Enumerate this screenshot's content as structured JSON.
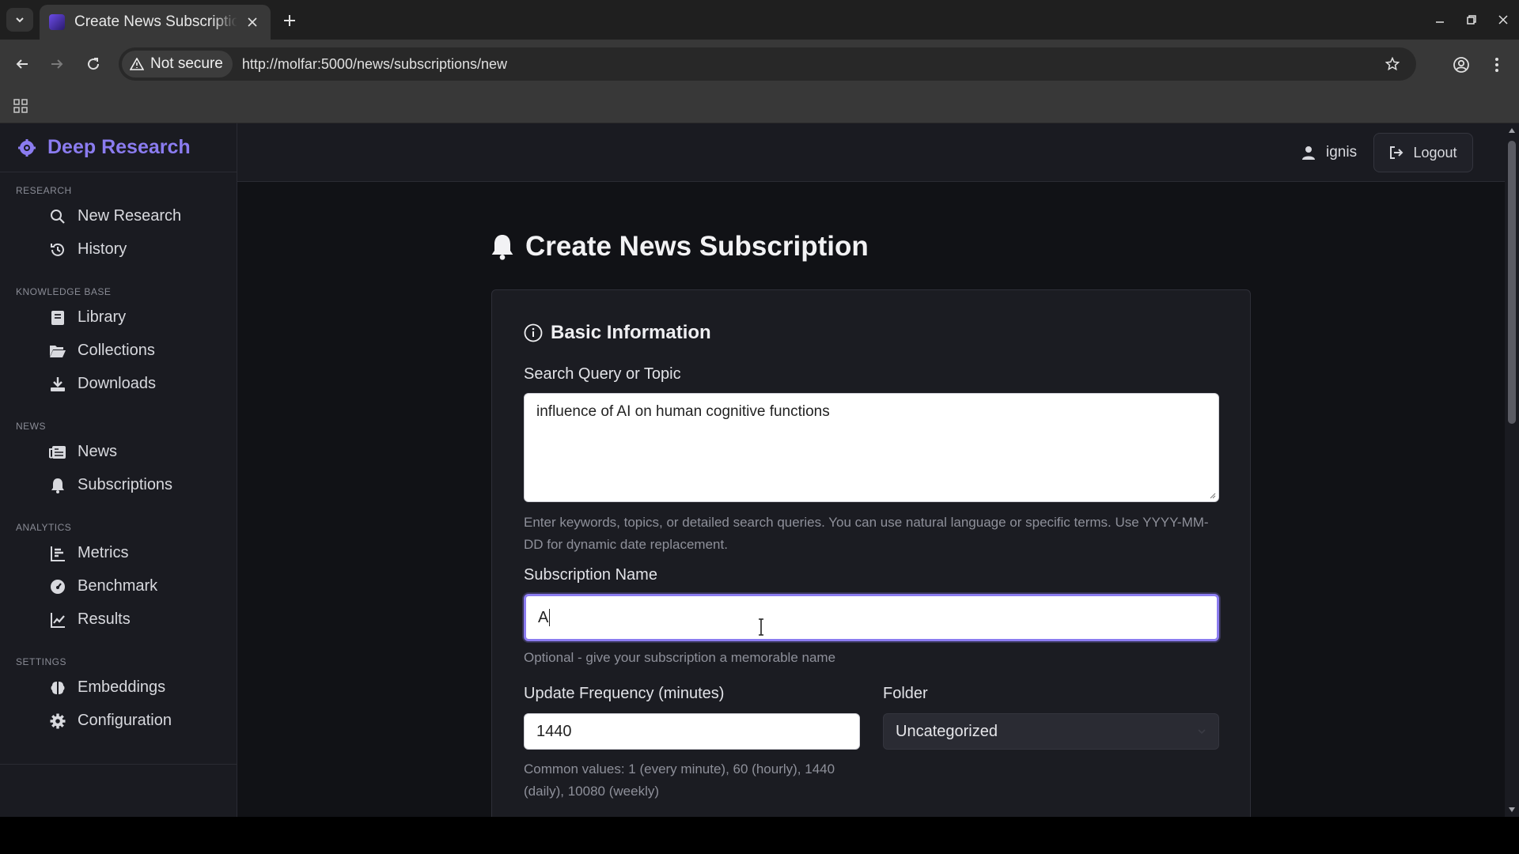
{
  "browser": {
    "tab_title": "Create News Subscription",
    "security_label": "Not secure",
    "url": "http://molfar:5000/news/subscriptions/new"
  },
  "app": {
    "brand": "Deep Research",
    "user": "ignis",
    "logout_label": "Logout"
  },
  "sidebar": {
    "sections": [
      {
        "label": "RESEARCH",
        "items": [
          {
            "label": "New Research",
            "icon": "search-icon"
          },
          {
            "label": "History",
            "icon": "history-icon"
          }
        ]
      },
      {
        "label": "KNOWLEDGE BASE",
        "items": [
          {
            "label": "Library",
            "icon": "book-icon"
          },
          {
            "label": "Collections",
            "icon": "folder-open-icon"
          },
          {
            "label": "Downloads",
            "icon": "download-icon"
          }
        ]
      },
      {
        "label": "NEWS",
        "items": [
          {
            "label": "News",
            "icon": "newspaper-icon"
          },
          {
            "label": "Subscriptions",
            "icon": "bell-icon"
          }
        ]
      },
      {
        "label": "ANALYTICS",
        "items": [
          {
            "label": "Metrics",
            "icon": "list-chart-icon"
          },
          {
            "label": "Benchmark",
            "icon": "gauge-icon"
          },
          {
            "label": "Results",
            "icon": "line-chart-icon"
          }
        ]
      },
      {
        "label": "SETTINGS",
        "items": [
          {
            "label": "Embeddings",
            "icon": "brain-icon"
          },
          {
            "label": "Configuration",
            "icon": "gear-icon"
          }
        ]
      }
    ]
  },
  "page": {
    "title": "Create News Subscription",
    "section_title": "Basic Information",
    "query": {
      "label": "Search Query or Topic",
      "value": "influence of AI on human cognitive functions",
      "hint": "Enter keywords, topics, or detailed search queries. You can use natural language or specific terms. Use YYYY-MM-DD for dynamic date replacement."
    },
    "name": {
      "label": "Subscription Name",
      "value": "A",
      "hint": "Optional - give your subscription a memorable name"
    },
    "frequency": {
      "label": "Update Frequency (minutes)",
      "value": "1440",
      "hint": "Common values: 1 (every minute), 60 (hourly), 1440 (daily), 10080 (weekly)"
    },
    "folder": {
      "label": "Folder",
      "value": "Uncategorized"
    }
  },
  "colors": {
    "accent": "#8b7cf0",
    "background": "#111216",
    "sidebar": "#1a1b21"
  }
}
